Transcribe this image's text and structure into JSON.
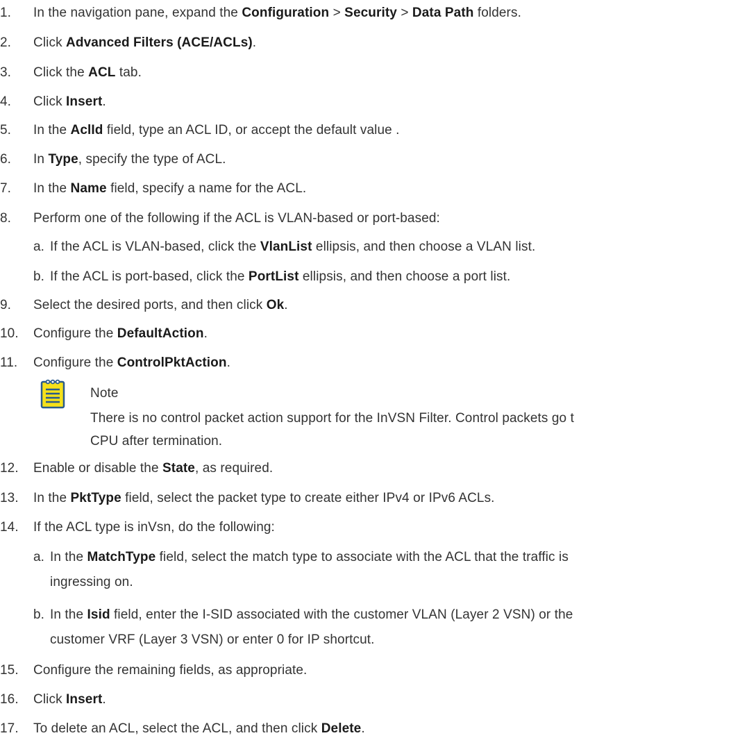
{
  "steps": [
    {
      "n": "1.",
      "parts": [
        "In the navigation pane, expand the ",
        "**Configuration",
        " > ",
        "**Security",
        " > ",
        "**Data Path",
        " folders."
      ]
    },
    {
      "n": "2.",
      "parts": [
        "Click ",
        "**Advanced Filters (ACE/ACLs)",
        "."
      ]
    },
    {
      "n": "3.",
      "parts": [
        "Click the ",
        "**ACL",
        " tab."
      ]
    },
    {
      "n": "4.",
      "parts": [
        "Click ",
        "**Insert",
        "."
      ]
    },
    {
      "n": "5.",
      "parts": [
        "In the ",
        "**AclId",
        " field, type an ACL ID, or accept the default value ."
      ]
    },
    {
      "n": "6.",
      "parts": [
        "In ",
        "**Type",
        ", specify the type of ACL."
      ]
    },
    {
      "n": "7.",
      "parts": [
        "In the ",
        "**Name",
        " field, specify a name for the ACL."
      ]
    },
    {
      "n": "8.",
      "parts": [
        "Perform one of the following if the ACL is VLAN-based or port-based:"
      ]
    },
    {
      "n": "a.",
      "sub": true,
      "parts": [
        "If the ACL is VLAN-based, click the ",
        "**VlanList",
        " ellipsis, and then choose a VLAN list."
      ]
    },
    {
      "n": "b.",
      "sub": true,
      "parts": [
        "If the ACL is port-based, click the ",
        "**PortList",
        " ellipsis, and then choose a port list."
      ]
    },
    {
      "n": "9.",
      "parts": [
        "Select the desired ports, and then click ",
        "**Ok",
        "."
      ]
    },
    {
      "n": "10.",
      "parts": [
        "Configure the ",
        "**DefaultAction",
        "."
      ]
    },
    {
      "n": "11.",
      "parts": [
        "Configure the ",
        "**ControlPktAction",
        "."
      ]
    },
    {
      "n": "12.",
      "parts": [
        "Enable or disable the ",
        "**State",
        ", as required."
      ]
    },
    {
      "n": "13.",
      "parts": [
        "In the ",
        "**PktType",
        " field, select the packet type to create either IPv4 or IPv6 ACLs."
      ]
    },
    {
      "n": "14.",
      "parts": [
        "If the ACL type is inVsn, do the following:"
      ]
    },
    {
      "n": "a.",
      "sub": true,
      "parts": [
        "In the ",
        "**MatchType",
        " field, select the match type to associate with the ACL that the traffic is"
      ]
    },
    {
      "n": "",
      "sub": true,
      "parts": [
        "ingressing on."
      ]
    },
    {
      "n": "b.",
      "sub": true,
      "parts": [
        "In the ",
        "**Isid",
        " field, enter the I-SID associated with the customer VLAN (Layer 2 VSN) or the"
      ]
    },
    {
      "n": "",
      "sub": true,
      "parts": [
        "customer VRF (Layer 3 VSN) or enter 0 for IP shortcut."
      ]
    },
    {
      "n": "15.",
      "parts": [
        "Configure the remaining fields, as appropriate."
      ]
    },
    {
      "n": "16.",
      "parts": [
        "Click ",
        "**Insert",
        "."
      ]
    },
    {
      "n": "17.",
      "parts": [
        "To delete an ACL, select the ACL, and then click ",
        "**Delete",
        "."
      ]
    }
  ],
  "note": {
    "title": "Note",
    "body_line1": "There is no control packet action support for the InVSN Filter. Control packets go t",
    "body_line2": "CPU after termination.",
    "icon": "note-icon",
    "icon_color": "#f5e11a",
    "icon_stroke": "#2a5b8c"
  }
}
